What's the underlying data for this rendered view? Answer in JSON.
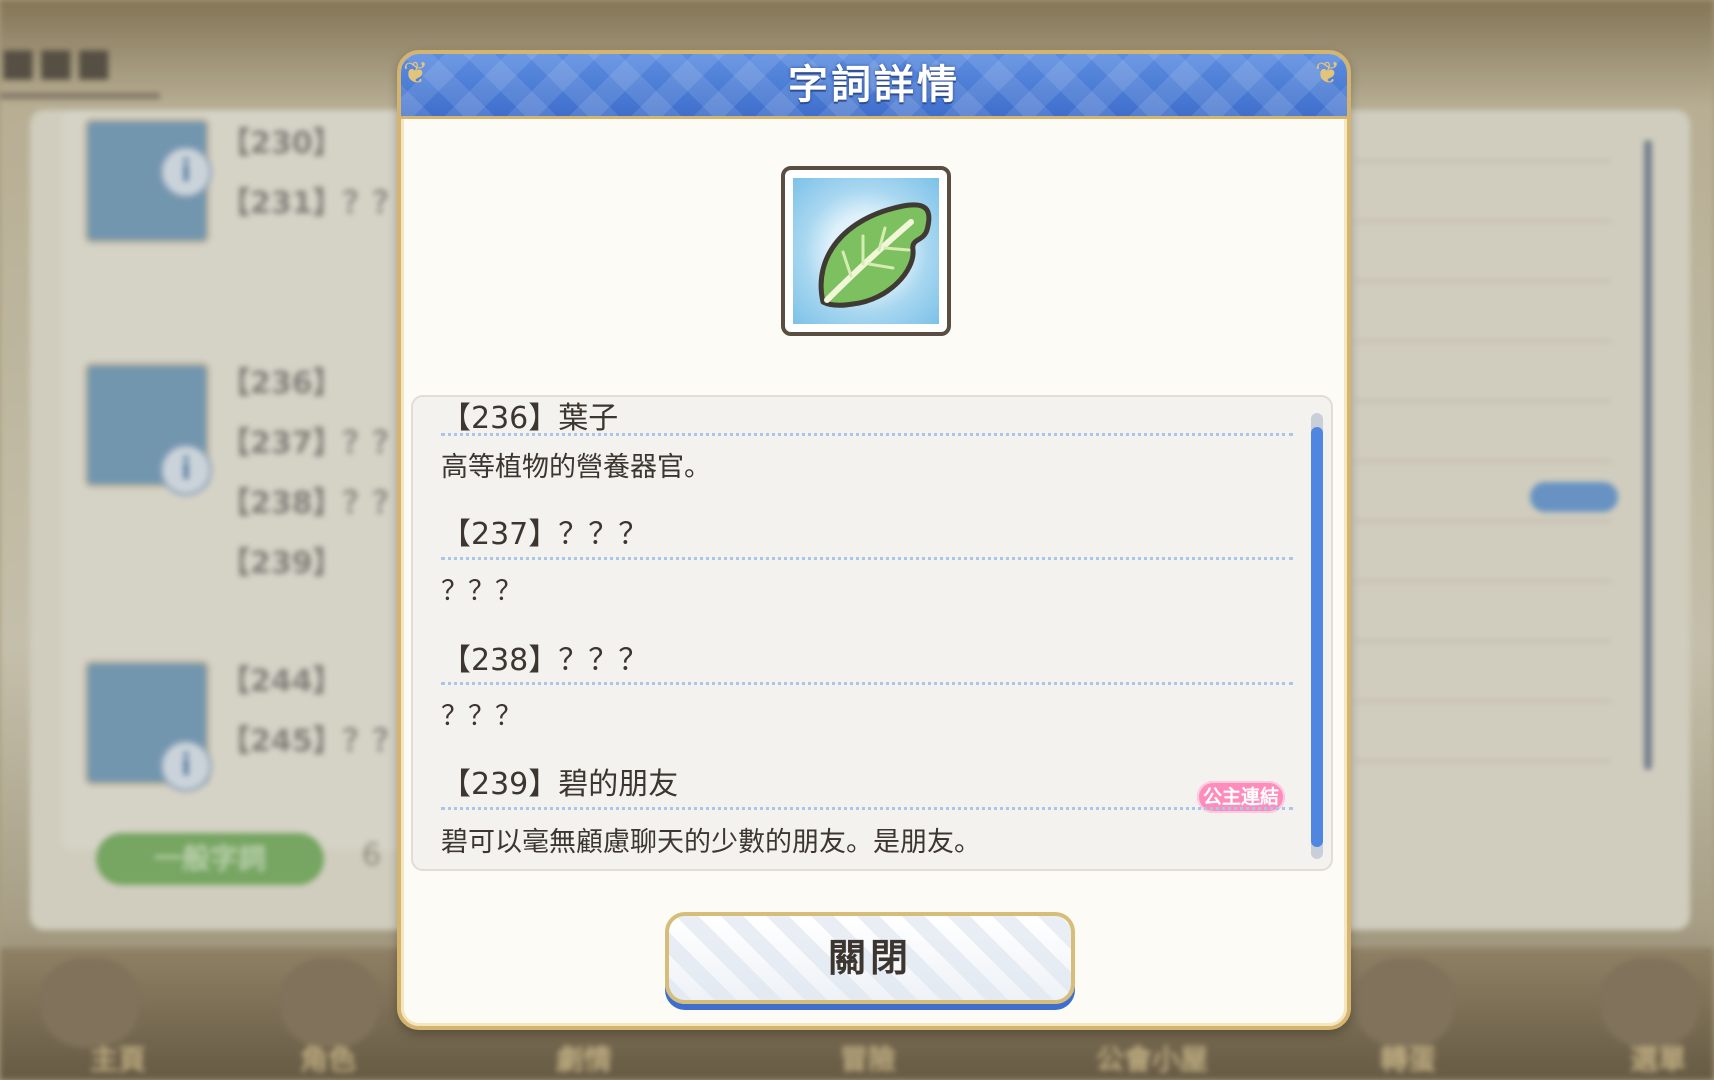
{
  "dialog": {
    "title": "字詞詳情",
    "close_label": "關閉",
    "icon": "leaf-icon",
    "entries": [
      {
        "title": "【236】葉子",
        "description": "高等植物的營養器官。"
      },
      {
        "title": "【237】？？？",
        "description": "？？？"
      },
      {
        "title": "【238】？？？",
        "description": "？？？"
      },
      {
        "title": "【239】碧的朋友",
        "description": "碧可以毫無顧慮聊天的少數的朋友。是朋友。",
        "tag": "公主連結"
      }
    ]
  },
  "background": {
    "rows": [
      "【230】",
      "【231】？？",
      "【236】",
      "【237】？？",
      "【238】？？",
      "【239】",
      "【244】",
      "【245】？？"
    ],
    "green_button": "一般字詞",
    "nav_labels": [
      "主頁",
      "角色",
      "劇情",
      "冒險",
      "公會小屋",
      "轉蛋",
      "選單"
    ]
  },
  "colors": {
    "header_blue": "#4a7bd6",
    "frame_gold": "#d5b470",
    "tag_pink": "#ff8dbb",
    "scroll_blue": "#4f86e0"
  }
}
